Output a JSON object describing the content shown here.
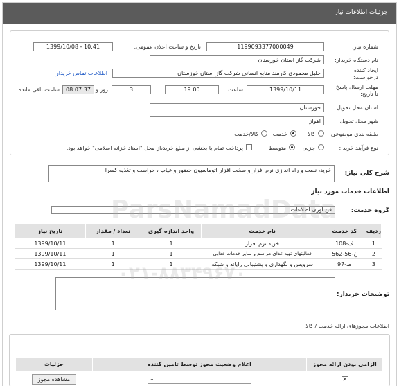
{
  "header": {
    "title": "جزئیات اطلاعات نیاز"
  },
  "form": {
    "need_number_label": "شماره نیاز:",
    "need_number": "1199093377000049",
    "announce_label": "تاریخ و ساعت اعلان عمومی:",
    "announce_value": "1399/10/08 - 10:41",
    "buyer_org_label": "نام دستگاه خریدار:",
    "buyer_org": "شرکت گاز استان خوزستان",
    "creator_label_1": "ایجاد کننده",
    "creator_label_2": "درخواست:",
    "creator": "جلیل محمودی کارمند منابع انسانی شرکت گاز استان خوزستان",
    "contact_link": "اطلاعات تماس خریدار",
    "deadline_label_1": "مهلت ارسال پاسخ:",
    "deadline_label_2": "تا تاریخ:",
    "deadline_date": "1399/10/11",
    "time_label": "ساعت",
    "deadline_time": "19:00",
    "days_value": "3",
    "days_label": "روز و",
    "remaining_time": "08:07:37",
    "remaining_label": "ساعت باقی مانده",
    "province_label": "استان محل تحویل:",
    "province": "خوزستان",
    "city_label": "شهر محل تحویل:",
    "city": "اهواز",
    "category_label": "طبقه بندی موضوعی:",
    "category_options": [
      "خدمت",
      "کالا/خدمت"
    ],
    "category_good": "کالا",
    "purchase_type_label": "نوع فرآیند خرید :",
    "purchase_options": [
      "جزیی",
      "متوسط"
    ],
    "payment_note": "پرداخت تمام یا بخشی از مبلغ خرید،از محل \"اسناد خزانه اسلامی\" خواهد بود."
  },
  "description": {
    "label": "شرح کلی نیاز:",
    "text": "خرید، نصب و راه اندازی نرم افزار و سخت افزار اتوماسیون حضور و غیاب ، حراست و تغذیه کسرا"
  },
  "services": {
    "section_title": "اطلاعات خدمات مورد نیاز",
    "group_label": "گروه خدمت:",
    "group_value": "فن آوری اطلاعات",
    "columns": [
      "ردیف",
      "کد خدمت",
      "نام خدمت",
      "واحد اندازه گیری",
      "تعداد / مقدار",
      "تاریخ نیاز"
    ],
    "rows": [
      {
        "idx": "1",
        "code": "ف-108",
        "name": "خرید نرم افزار",
        "unit": "1",
        "qty": "1",
        "date": "1399/10/11"
      },
      {
        "idx": "2",
        "code": "خ-56-562",
        "name": "فعالیتهای تهیه غذای مراسم و سایر خدمات غذایی",
        "unit": "1",
        "qty": "1",
        "date": "1399/10/11"
      },
      {
        "idx": "3",
        "code": "ط-97",
        "name": "سرویس و نگهداری و پشتیبانی رایانه و شبکه",
        "unit": "1",
        "qty": "1",
        "date": "1399/10/11"
      }
    ]
  },
  "buyer_notes": {
    "label": "توضیحات خریدار:"
  },
  "permits": {
    "title": "اطلاعات مجوزهای ارائه خدمت / کالا",
    "columns": [
      "الزامی بودن ارائه مجوز",
      "اعلام وضعیت مجوز توسط تامین کننده",
      "جزئیات"
    ],
    "view_button": "مشاهده مجوز"
  },
  "watermark": {
    "brand": "ParsNamadData",
    "phone": "۰۲۱-۸۸۳۴۹۶۷۰"
  }
}
